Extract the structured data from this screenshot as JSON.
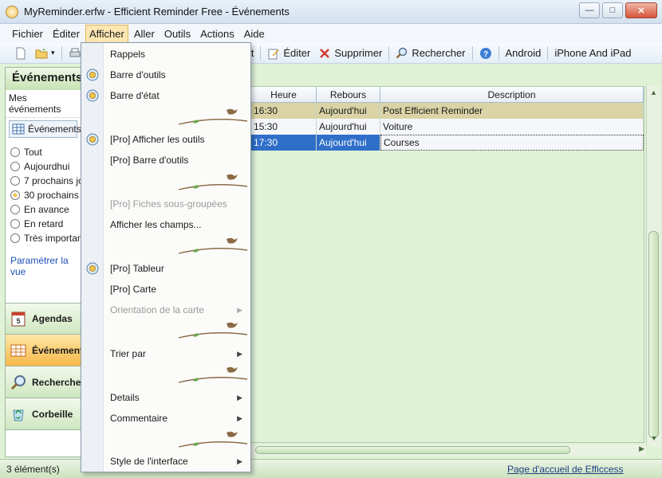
{
  "window": {
    "title": "MyReminder.erfw - Efficient Reminder Free - Événements"
  },
  "menubar": {
    "items": [
      "Fichier",
      "Éditer",
      "Afficher",
      "Aller",
      "Outils",
      "Actions",
      "Aide"
    ],
    "active": "Afficher"
  },
  "toolbar": {
    "visible_buttons": [
      {
        "label": "nt",
        "icon": "new-event-icon"
      },
      {
        "label": "Éditer",
        "icon": "edit-icon"
      },
      {
        "label": "Supprimer",
        "icon": "delete-icon"
      },
      {
        "label": "Rechercher",
        "icon": "search-icon"
      },
      {
        "label": "",
        "icon": "help-icon"
      },
      {
        "label": "Android",
        "icon": ""
      },
      {
        "label": "iPhone And iPad",
        "icon": ""
      }
    ]
  },
  "leftpanel": {
    "title": "Événements",
    "subtitle": "Mes événements",
    "view_label": "Événements",
    "filters": [
      {
        "label": "Tout",
        "selected": false
      },
      {
        "label": "Aujourdhui",
        "selected": false
      },
      {
        "label": "7 prochains jours",
        "selected": false
      },
      {
        "label": "30 prochains jours",
        "selected": true
      },
      {
        "label": "En avance",
        "selected": false
      },
      {
        "label": "En retard",
        "selected": false
      },
      {
        "label": "Très important",
        "selected": false
      }
    ],
    "link": "Paramétrer la vue"
  },
  "nav": {
    "items": [
      {
        "label": "Agendas",
        "icon": "calendar-icon",
        "active": false
      },
      {
        "label": "Événements",
        "icon": "events-icon",
        "active": true
      },
      {
        "label": "Rechercher",
        "icon": "search-icon",
        "active": false
      },
      {
        "label": "Corbeille",
        "icon": "recycle-bin-icon",
        "active": false
      }
    ]
  },
  "grid": {
    "columns": [
      "Heure",
      "Rebours",
      "Description"
    ],
    "rows": [
      {
        "heure": "16:30",
        "rebours": "Aujourd'hui",
        "description": "Post Efficient Reminder"
      },
      {
        "heure": "15:30",
        "rebours": "Aujourd'hui",
        "description": "Voiture"
      },
      {
        "heure": "17:30",
        "rebours": "Aujourd'hui",
        "description": "Courses"
      }
    ]
  },
  "dropdown": {
    "items": [
      {
        "label": "Rappels",
        "icon": "",
        "disabled": false,
        "submenu": false
      },
      {
        "label": "Barre d'outils",
        "icon": "flower-icon",
        "disabled": false,
        "submenu": false
      },
      {
        "label": "Barre d'état",
        "icon": "flower-icon",
        "disabled": false,
        "submenu": false
      },
      {
        "label": "[Pro] Afficher les outils",
        "icon": "flower-icon",
        "disabled": false,
        "submenu": false
      },
      {
        "label": "[Pro] Barre d'outils",
        "icon": "",
        "disabled": false,
        "submenu": false
      },
      {
        "label": "[Pro] Fiches sous-groupées",
        "icon": "",
        "disabled": true,
        "submenu": false
      },
      {
        "label": "Afficher les champs...",
        "icon": "",
        "disabled": false,
        "submenu": false
      },
      {
        "label": "[Pro] Tableur",
        "icon": "flower-icon",
        "disabled": false,
        "submenu": false
      },
      {
        "label": "[Pro] Carte",
        "icon": "",
        "disabled": false,
        "submenu": false
      },
      {
        "label": "Orientation de la carte",
        "icon": "",
        "disabled": true,
        "submenu": true
      },
      {
        "label": "Trier par",
        "icon": "",
        "disabled": false,
        "submenu": true
      },
      {
        "label": "Details",
        "icon": "",
        "disabled": false,
        "submenu": true
      },
      {
        "label": "Commentaire",
        "icon": "",
        "disabled": false,
        "submenu": true
      },
      {
        "label": "Style de l'interface",
        "icon": "",
        "disabled": false,
        "submenu": true
      }
    ]
  },
  "status": {
    "count": "3 élément(s)",
    "link": "Page d'accueil de Efficcess"
  },
  "colors": {
    "accent_green": "#dff2d6",
    "selection_blue": "#2f6fc9",
    "menu_highlight": "#fce7b2"
  }
}
